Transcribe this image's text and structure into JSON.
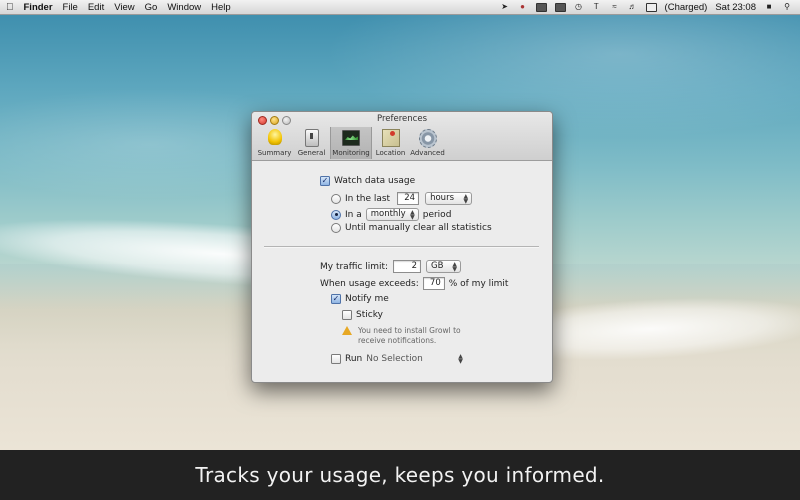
{
  "menubar": {
    "apple": "",
    "app": "Finder",
    "menus": [
      "File",
      "Edit",
      "View",
      "Go",
      "Window",
      "Help"
    ],
    "battery_status": "(Charged)",
    "clock": "Sat 23:08"
  },
  "window": {
    "title": "Preferences",
    "tabs": [
      {
        "label": "Summary",
        "icon": "lightbulb-icon"
      },
      {
        "label": "General",
        "icon": "switch-icon"
      },
      {
        "label": "Monitoring",
        "icon": "monitor-icon"
      },
      {
        "label": "Location",
        "icon": "map-icon"
      },
      {
        "label": "Advanced",
        "icon": "gear-icon"
      }
    ],
    "selected_tab": "Monitoring",
    "monitoring": {
      "watch_label": "Watch data usage",
      "watch_checked": true,
      "in_last_label": "In the last",
      "in_last_value": "24",
      "in_last_unit": "hours",
      "in_a_label": "In a",
      "in_a_value": "monthly",
      "period_label": "period",
      "until_label": "Until manually clear all statistics",
      "selected_option": "in_a",
      "traffic_limit_label": "My traffic limit:",
      "traffic_limit_value": "2",
      "traffic_limit_unit": "GB",
      "usage_exceeds_label": "When usage exceeds:",
      "usage_exceeds_value": "70",
      "usage_exceeds_suffix": "% of my limit",
      "notify_label": "Notify me",
      "notify_checked": true,
      "sticky_label": "Sticky",
      "sticky_checked": false,
      "growl_warning": "You need to install Growl to receive notifications.",
      "run_label": "Run",
      "run_value": "No Selection",
      "run_checked": false
    }
  },
  "caption": "Tracks your usage, keeps you informed."
}
